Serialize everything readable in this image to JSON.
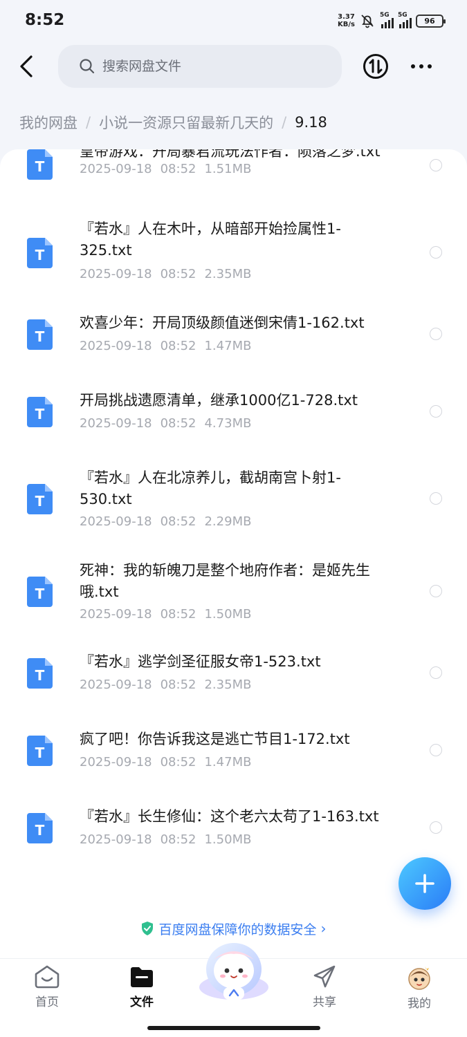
{
  "status_bar": {
    "time": "8:52",
    "net_speed_value": "3.37",
    "net_speed_unit": "KB/s",
    "sim1": "5G",
    "sim2": "5G",
    "battery": "96"
  },
  "header": {
    "search_placeholder": "搜索网盘文件"
  },
  "breadcrumb": {
    "items": [
      "我的网盘",
      "小说一资源只留最新几天的",
      "9.18"
    ],
    "separator": "/"
  },
  "files": [
    {
      "name": "皇帝游戏：开局暴君流玩法作者：陨落之梦.txt",
      "date": "2025-09-18",
      "time": "08:52",
      "size": "1.51MB"
    },
    {
      "name": "『若水』人在木叶，从暗部开始捡属性1-325.txt",
      "date": "2025-09-18",
      "time": "08:52",
      "size": "2.35MB"
    },
    {
      "name": "欢喜少年：开局顶级颜值迷倒宋倩1-162.txt",
      "date": "2025-09-18",
      "time": "08:52",
      "size": "1.47MB"
    },
    {
      "name": "开局挑战遗愿清单，继承1000亿1-728.txt",
      "date": "2025-09-18",
      "time": "08:52",
      "size": "4.73MB"
    },
    {
      "name": "『若水』人在北凉养儿，截胡南宫卜射1-530.txt",
      "date": "2025-09-18",
      "time": "08:52",
      "size": "2.29MB"
    },
    {
      "name": "死神：我的斩魄刀是整个地府作者：是姬先生哦.txt",
      "date": "2025-09-18",
      "time": "08:52",
      "size": "1.50MB"
    },
    {
      "name": "『若水』逃学剑圣征服女帝1-523.txt",
      "date": "2025-09-18",
      "time": "08:52",
      "size": "2.35MB"
    },
    {
      "name": "疯了吧！你告诉我这是逃亡节目1-172.txt",
      "date": "2025-09-18",
      "time": "08:52",
      "size": "1.47MB"
    },
    {
      "name": "『若水』长生修仙：这个老六太苟了1-163.txt",
      "date": "2025-09-18",
      "time": "08:52",
      "size": "1.50MB"
    }
  ],
  "file_icon_letter": "T",
  "security_banner": "百度网盘保障你的数据安全",
  "bottom_nav": {
    "home": "首页",
    "files": "文件",
    "share": "共享",
    "mine": "我的"
  },
  "colors": {
    "accent": "#3b7ef0",
    "file_icon": "#3f8cf5",
    "fab_start": "#4dc9ff",
    "fab_end": "#2a7cf7"
  }
}
